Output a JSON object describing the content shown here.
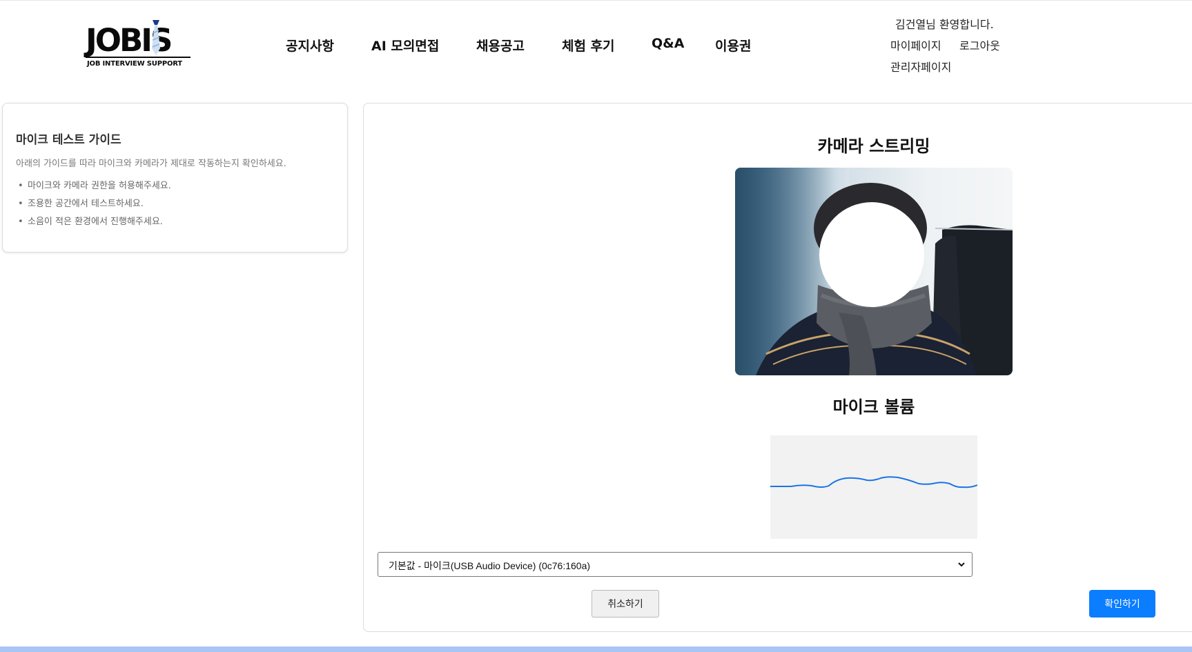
{
  "brand": {
    "logo_text": "JOBIS",
    "logo_sub": "JOB INTERVIEW SUPPORT"
  },
  "nav": {
    "items": [
      {
        "label": "공지사항"
      },
      {
        "label": "AI 모의면접"
      },
      {
        "label": "채용공고"
      },
      {
        "label": "체험 후기"
      },
      {
        "label": "Q&A"
      },
      {
        "label": "이용권"
      }
    ]
  },
  "user": {
    "welcome": "김건열님 환영합니다.",
    "mypage": "마이페이지",
    "logout": "로그아웃",
    "admin": "관리자페이지"
  },
  "guide": {
    "title": "마이크 테스트 가이드",
    "description": "아래의 가이드를 따라 마이크와 카메라가 제대로 작동하는지 확인하세요.",
    "items": [
      "마이크와 카메라 권한을 허용해주세요.",
      "조용한 공간에서 테스트하세요.",
      "소음이 적은 환경에서 진행해주세요."
    ]
  },
  "main": {
    "camera_title": "카메라 스트리밍",
    "mic_title": "마이크 볼륨",
    "mic_select": {
      "value": "기본값 - 마이크(USB Audio Device) (0c76:160a)"
    },
    "cancel_label": "취소하기",
    "confirm_label": "확인하기"
  },
  "colors": {
    "accent": "#0b7dff",
    "waveform": "#1a73e8",
    "bottom_bar": "#a9c4f5"
  }
}
